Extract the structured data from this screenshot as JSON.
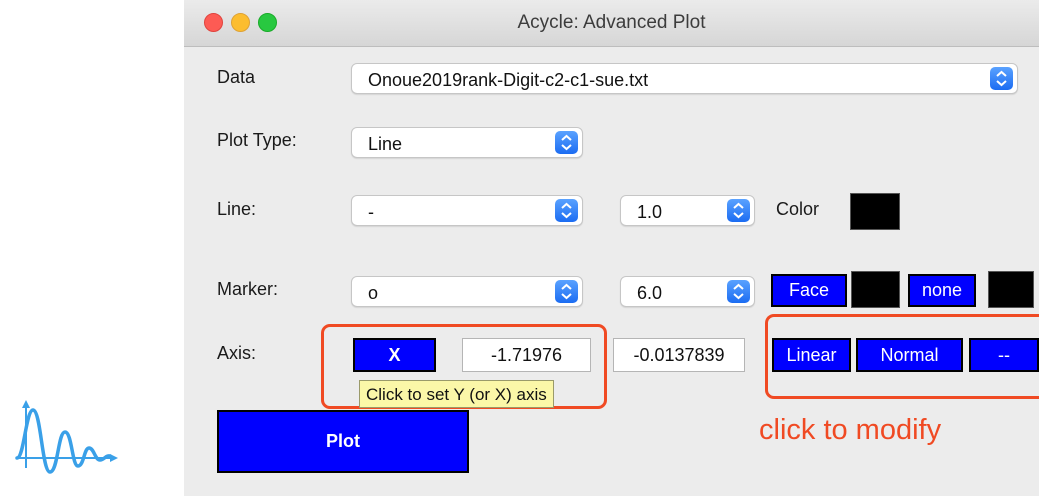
{
  "window": {
    "title": "Acycle: Advanced Plot"
  },
  "colors": {
    "accent_blue": "#0000ff",
    "highlight": "#f04a23",
    "tooltip_bg": "#fbf7a8",
    "close": "#fd5b54",
    "minimize": "#fcbd2f",
    "zoom": "#28c840"
  },
  "icons": {
    "app_logo": "signal-wave-icon",
    "stepper": "up-down-chevron-icon"
  },
  "data_row": {
    "label": "Data",
    "value": "Onoue2019rank-Digit-c2-c1-sue.txt"
  },
  "plot_type_row": {
    "label": "Plot Type:",
    "value": "Line"
  },
  "line_row": {
    "label": "Line:",
    "style": "-",
    "width": "1.0",
    "color_label": "Color"
  },
  "marker_row": {
    "label": "Marker:",
    "symbol": "o",
    "size": "6.0",
    "face_label": "Face",
    "edge_label": "none"
  },
  "axis_row": {
    "label": "Axis:",
    "axis_button": "X",
    "min": "-1.71976",
    "max": "-0.0137839",
    "scale_button": "Linear",
    "direction_button": "Normal",
    "grid_button": "--"
  },
  "tooltip": "Click to set Y (or X) axis",
  "plot_button": "Plot",
  "annotation": "click to modify"
}
